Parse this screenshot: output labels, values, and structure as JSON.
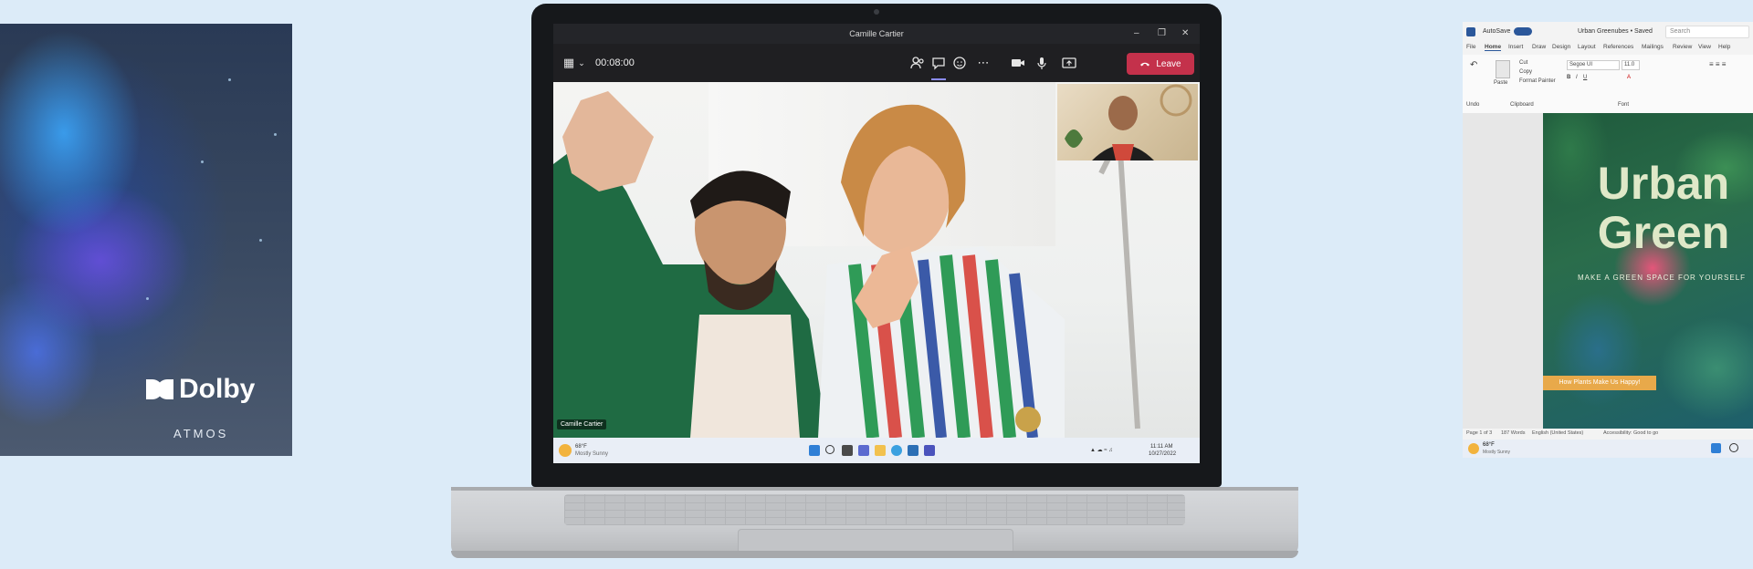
{
  "dolby": {
    "brand": "Dolby",
    "subtitle": "ATMOS"
  },
  "teams": {
    "window_title": "Camille Cartier",
    "call_timer": "00:08:00",
    "leave_label": "Leave",
    "participant_name": "Camille Cartier",
    "toolbar_icons": [
      "people-icon",
      "chat-icon",
      "react-icon",
      "more-icon",
      "camera-icon",
      "mic-icon",
      "share-icon"
    ]
  },
  "taskbar": {
    "weather_temp": "68°F",
    "weather_desc": "Mostly Sunny",
    "time": "11:11 AM",
    "date": "10/27/2022"
  },
  "word": {
    "autosave": "AutoSave",
    "doc_title": "Urban Greenubes • Saved",
    "search_placeholder": "Search",
    "tabs": [
      "File",
      "Home",
      "Insert",
      "Draw",
      "Design",
      "Layout",
      "References",
      "Mailings",
      "Review",
      "View",
      "Help"
    ],
    "ribbon": {
      "paste": "Paste",
      "cut": "Cut",
      "copy": "Copy",
      "format_painter": "Format Painter",
      "font_name": "Segoe UI",
      "font_size": "11.0",
      "clipboard_group": "Clipboard",
      "font_group": "Font",
      "undo_group": "Undo"
    },
    "doc": {
      "title": "Urban Green",
      "subtitle": "MAKE A GREEN SPACE FOR YOURSELF",
      "button": "How Plants Make Us Happy!"
    },
    "status": {
      "page": "Page 1 of 3",
      "words": "187 Words",
      "language": "English (United States)",
      "accessibility": "Accessibility: Good to go"
    },
    "weather_temp": "68°F",
    "weather_desc": "Mostly Sunny"
  }
}
